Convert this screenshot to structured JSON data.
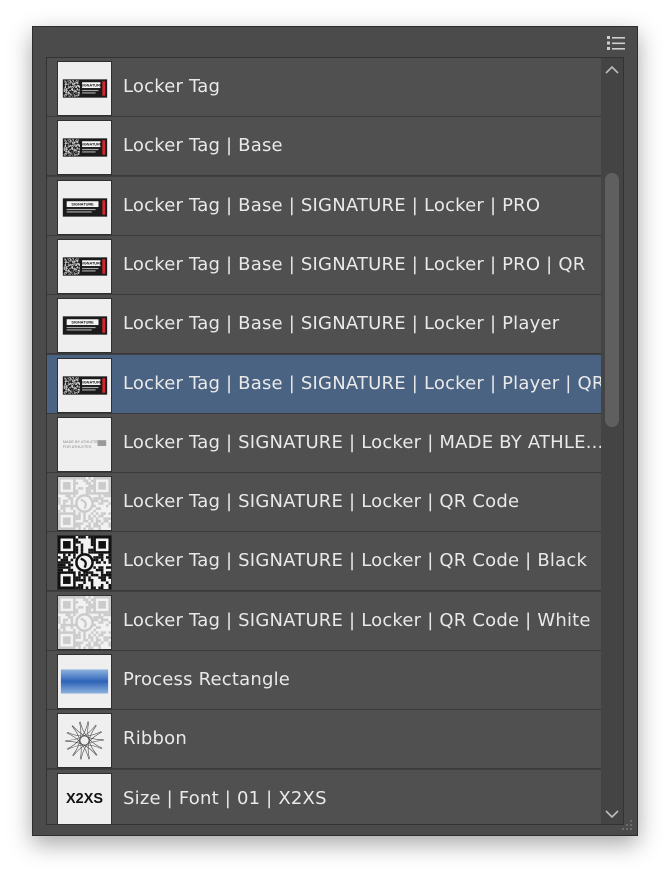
{
  "panel": {
    "menu_icon": "panel-menu-icon",
    "items": [
      {
        "label": "Locker Tag",
        "thumb": "tag"
      },
      {
        "label": "Locker Tag | Base",
        "thumb": "tag"
      },
      {
        "label": "Locker Tag | Base | SIGNATURE | Locker | PRO",
        "thumb": "sig"
      },
      {
        "label": "Locker Tag | Base | SIGNATURE | Locker | PRO | QR",
        "thumb": "tag"
      },
      {
        "label": "Locker Tag | Base | SIGNATURE | Locker | Player",
        "thumb": "sig"
      },
      {
        "label": "Locker Tag | Base | SIGNATURE | Locker | Player | QR",
        "thumb": "tag",
        "selected": true
      },
      {
        "label": "Locker Tag | SIGNATURE | Locker | MADE BY ATHLE...",
        "thumb": "made"
      },
      {
        "label": "Locker Tag | SIGNATURE | Locker | QR Code",
        "thumb": "qrlight"
      },
      {
        "label": "Locker Tag | SIGNATURE | Locker | QR Code | Black",
        "thumb": "qrblack"
      },
      {
        "label": "Locker Tag | SIGNATURE | Locker | QR Code | White",
        "thumb": "qrlight"
      },
      {
        "label": "Process Rectangle",
        "thumb": "blue"
      },
      {
        "label": "Ribbon",
        "thumb": "ribbon"
      },
      {
        "label": "Size | Font | 01 | X2XS",
        "thumb": "size"
      }
    ],
    "thumb_text": {
      "signature": "SIGNATURE",
      "made_line1": "MADE BY ATHLETES",
      "made_line2": "FOR ATHLETES",
      "size_text": "X2XS"
    }
  }
}
